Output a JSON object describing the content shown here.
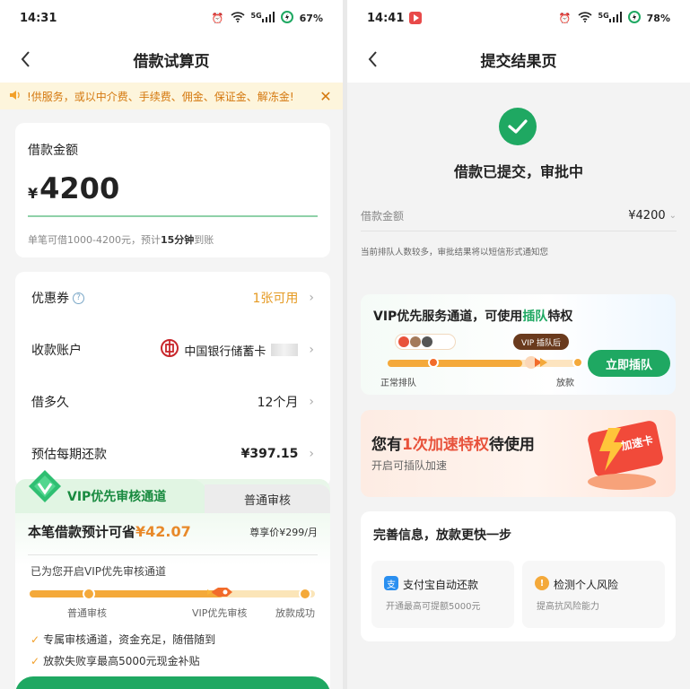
{
  "left": {
    "status": {
      "time": "14:31",
      "net": "5G",
      "battery": "67%"
    },
    "nav": {
      "title": "借款试算页"
    },
    "notice": {
      "text": "!供服务，或以中介费、手续费、佣金、保证金、解冻金!"
    },
    "loan": {
      "label": "借款金额",
      "currency": "¥",
      "amount": "4200",
      "hint_prefix": "单笔可借1000-4200元，预计",
      "hint_time": "15分钟",
      "hint_suffix": "到账"
    },
    "rows": [
      {
        "label": "优惠券",
        "value": "1张可用"
      },
      {
        "label": "收款账户",
        "value": "中国银行储蓄卡"
      },
      {
        "label": "借多久",
        "value": "12个月"
      },
      {
        "label": "预估每期还款",
        "value": "¥397.15"
      }
    ],
    "vip": {
      "tab_vip": "VIP优先审核通道",
      "tab_normal": "普通审核",
      "save_prefix": "本笔借款预计可省",
      "save_amount": "¥42.07",
      "price": "尊享价¥299/月",
      "opened": "已为您开启VIP优先审核通道",
      "steps": [
        "普通审核",
        "VIP优先审核",
        "放款成功"
      ],
      "benefits": [
        "专属审核通道，资金充足，随借随到",
        "放款失败享最高5000元现金补贴"
      ]
    }
  },
  "right": {
    "status": {
      "time": "14:41",
      "net": "5G",
      "battery": "78%"
    },
    "nav": {
      "title": "提交结果页"
    },
    "result": {
      "title": "借款已提交，审批中"
    },
    "amount_row": {
      "label": "借款金额",
      "value": "¥4200"
    },
    "queue_note": "当前排队人数较多，审批结果将以短信形式通知您",
    "vip_card": {
      "title_prefix": "VIP优先服务通道，可使用",
      "title_highlight": "插队",
      "title_suffix": "特权",
      "badge": "VIP 插队后",
      "left_label": "正常排队",
      "right_label": "放款",
      "button": "立即插队"
    },
    "accel": {
      "title_prefix": "您有",
      "title_highlight": "1次加速特权",
      "title_suffix": "待使用",
      "sub": "开启可插队加速",
      "card_label": "加速卡"
    },
    "improve": {
      "title": "完善信息，放款更快一步",
      "items": [
        {
          "icon": "支",
          "title": "支付宝自动还款",
          "sub": "开通最高可提额5000元"
        },
        {
          "icon": "!",
          "title": "检测个人风险",
          "sub": "提高抗风险能力"
        }
      ]
    }
  },
  "colors": {
    "green": "#1fa862",
    "orange": "#f4a93a",
    "red": "#e8523b"
  }
}
